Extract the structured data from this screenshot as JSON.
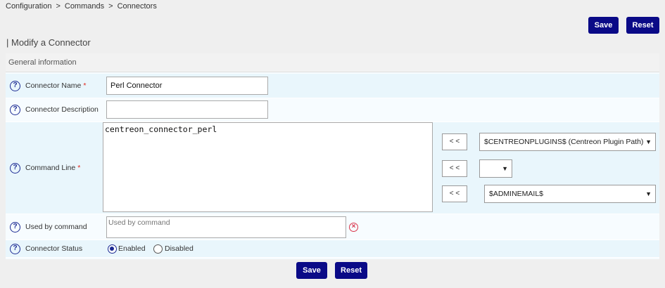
{
  "breadcrumb": [
    "Configuration",
    "Commands",
    "Connectors"
  ],
  "breadcrumb_sep": ">",
  "top_actions": {
    "save_label": "Save",
    "reset_label": "Reset"
  },
  "page_title": "| Modify a Connector",
  "section_title": "General information",
  "help_glyph": "?",
  "required_mark": "*",
  "fields": {
    "name": {
      "label": "Connector Name",
      "value": "Perl Connector"
    },
    "description": {
      "label": "Connector Description",
      "value": ""
    },
    "command_line": {
      "label": "Command Line",
      "value": "centreon_connector_perl"
    },
    "used_by": {
      "label": "Used by command",
      "placeholder": "Used by command"
    },
    "status": {
      "label": "Connector Status",
      "options": [
        "Enabled",
        "Disabled"
      ],
      "selected": "Enabled"
    }
  },
  "macro_inserts": [
    {
      "button_label": "< <",
      "selected": "$CENTREONPLUGINS$ (Centreon Plugin Path)"
    },
    {
      "button_label": "< <",
      "selected": ""
    },
    {
      "button_label": "< <",
      "selected": "$ADMINEMAIL$"
    }
  ],
  "bottom_actions": {
    "save_label": "Save",
    "reset_label": "Reset"
  },
  "colors": {
    "accent": "#0a0a87",
    "required": "#e0251b",
    "delete": "#d9344a"
  },
  "icons": {
    "help": "help-circle-icon",
    "delete": "delete-circle-icon",
    "dropdown": "chevron-down-icon"
  }
}
